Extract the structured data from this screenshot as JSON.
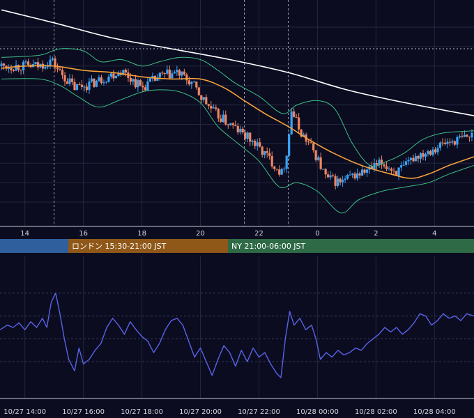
{
  "chart_data": [
    {
      "type": "candlestick",
      "panel": "price",
      "x_unit": "hour",
      "x_range": [
        13.15,
        29.35
      ],
      "y_range": [
        0,
        100
      ],
      "x_ticks": [
        {
          "x": 14,
          "label": "14"
        },
        {
          "x": 16,
          "label": "16"
        },
        {
          "x": 18,
          "label": "18"
        },
        {
          "x": 20,
          "label": "20"
        },
        {
          "x": 22,
          "label": "22"
        },
        {
          "x": 24,
          "label": "0"
        },
        {
          "x": 26,
          "label": "2"
        },
        {
          "x": 28,
          "label": "4"
        }
      ],
      "grid": true,
      "y_gridlines": [
        90,
        81,
        72,
        63,
        54,
        45,
        36,
        27,
        18,
        9
      ],
      "dashed_level": 80,
      "vertical_markers": [
        15,
        21.5,
        23
      ],
      "colors": {
        "up": "#3ba3f5",
        "down": "#f08560",
        "background": "#0b0c20"
      },
      "key_points": [
        {
          "x": 13.2,
          "y": 72
        },
        {
          "x": 14.0,
          "y": 72
        },
        {
          "x": 14.5,
          "y": 72
        },
        {
          "x": 14.9,
          "y": 75
        },
        {
          "x": 15.2,
          "y": 69
        },
        {
          "x": 15.7,
          "y": 62
        },
        {
          "x": 16.3,
          "y": 64
        },
        {
          "x": 16.8,
          "y": 67
        },
        {
          "x": 17.3,
          "y": 70
        },
        {
          "x": 18.0,
          "y": 62
        },
        {
          "x": 18.6,
          "y": 67
        },
        {
          "x": 19.2,
          "y": 69
        },
        {
          "x": 19.7,
          "y": 64
        },
        {
          "x": 20.0,
          "y": 58
        },
        {
          "x": 20.5,
          "y": 50
        },
        {
          "x": 21.0,
          "y": 45
        },
        {
          "x": 21.7,
          "y": 38
        },
        {
          "x": 22.3,
          "y": 30
        },
        {
          "x": 22.8,
          "y": 22
        },
        {
          "x": 23.0,
          "y": 36
        },
        {
          "x": 23.1,
          "y": 52
        },
        {
          "x": 23.4,
          "y": 42
        },
        {
          "x": 23.9,
          "y": 32
        },
        {
          "x": 24.3,
          "y": 20
        },
        {
          "x": 24.8,
          "y": 18
        },
        {
          "x": 25.2,
          "y": 21
        },
        {
          "x": 25.8,
          "y": 24
        },
        {
          "x": 26.2,
          "y": 27
        },
        {
          "x": 26.7,
          "y": 23
        },
        {
          "x": 27.0,
          "y": 25
        },
        {
          "x": 27.3,
          "y": 30
        },
        {
          "x": 27.8,
          "y": 33
        },
        {
          "x": 28.3,
          "y": 36
        },
        {
          "x": 29.35,
          "y": 40
        }
      ],
      "indicators": [
        {
          "kind": "moving_average",
          "color": "#ffffff",
          "points": [
            {
              "x": 13.2,
              "y": 98
            },
            {
              "x": 15.0,
              "y": 92
            },
            {
              "x": 17.0,
              "y": 85
            },
            {
              "x": 19.0,
              "y": 80
            },
            {
              "x": 21.0,
              "y": 75
            },
            {
              "x": 23.0,
              "y": 69
            },
            {
              "x": 25.0,
              "y": 61
            },
            {
              "x": 27.0,
              "y": 55
            },
            {
              "x": 29.35,
              "y": 49
            }
          ]
        },
        {
          "kind": "moving_average",
          "color": "#f5a23a",
          "points": [
            {
              "x": 13.2,
              "y": 71
            },
            {
              "x": 14.0,
              "y": 72
            },
            {
              "x": 15.0,
              "y": 72
            },
            {
              "x": 16.0,
              "y": 70
            },
            {
              "x": 17.0,
              "y": 69
            },
            {
              "x": 18.0,
              "y": 67
            },
            {
              "x": 19.0,
              "y": 66
            },
            {
              "x": 20.0,
              "y": 66
            },
            {
              "x": 20.8,
              "y": 62
            },
            {
              "x": 21.5,
              "y": 56
            },
            {
              "x": 22.2,
              "y": 50
            },
            {
              "x": 23.0,
              "y": 44
            },
            {
              "x": 23.7,
              "y": 38
            },
            {
              "x": 24.5,
              "y": 32
            },
            {
              "x": 25.5,
              "y": 26
            },
            {
              "x": 26.5,
              "y": 22
            },
            {
              "x": 27.2,
              "y": 20
            },
            {
              "x": 27.8,
              "y": 22
            },
            {
              "x": 28.5,
              "y": 26
            },
            {
              "x": 29.35,
              "y": 30
            }
          ]
        },
        {
          "kind": "bollinger_upper",
          "color": "#3dbf86",
          "points": [
            {
              "x": 13.2,
              "y": 76
            },
            {
              "x": 14.5,
              "y": 77
            },
            {
              "x": 15.2,
              "y": 80
            },
            {
              "x": 16.0,
              "y": 79
            },
            {
              "x": 16.6,
              "y": 74
            },
            {
              "x": 17.3,
              "y": 75
            },
            {
              "x": 18.0,
              "y": 72
            },
            {
              "x": 18.6,
              "y": 74
            },
            {
              "x": 19.3,
              "y": 76
            },
            {
              "x": 20.0,
              "y": 75
            },
            {
              "x": 20.6,
              "y": 70
            },
            {
              "x": 21.2,
              "y": 64
            },
            {
              "x": 22.0,
              "y": 58
            },
            {
              "x": 22.8,
              "y": 50
            },
            {
              "x": 23.3,
              "y": 54
            },
            {
              "x": 24.0,
              "y": 56
            },
            {
              "x": 24.6,
              "y": 52
            },
            {
              "x": 25.2,
              "y": 36
            },
            {
              "x": 25.8,
              "y": 26
            },
            {
              "x": 26.4,
              "y": 28
            },
            {
              "x": 27.0,
              "y": 32
            },
            {
              "x": 27.6,
              "y": 38
            },
            {
              "x": 28.3,
              "y": 41
            },
            {
              "x": 29.35,
              "y": 42
            }
          ]
        },
        {
          "kind": "bollinger_lower",
          "color": "#3dbf86",
          "points": [
            {
              "x": 13.2,
              "y": 66
            },
            {
              "x": 14.5,
              "y": 66
            },
            {
              "x": 15.2,
              "y": 63
            },
            {
              "x": 15.8,
              "y": 58
            },
            {
              "x": 16.5,
              "y": 53
            },
            {
              "x": 17.2,
              "y": 56
            },
            {
              "x": 18.0,
              "y": 60
            },
            {
              "x": 18.6,
              "y": 61
            },
            {
              "x": 19.3,
              "y": 60
            },
            {
              "x": 20.0,
              "y": 55
            },
            {
              "x": 20.6,
              "y": 44
            },
            {
              "x": 21.3,
              "y": 36
            },
            {
              "x": 22.0,
              "y": 28
            },
            {
              "x": 22.7,
              "y": 16
            },
            {
              "x": 23.3,
              "y": 18
            },
            {
              "x": 24.0,
              "y": 14
            },
            {
              "x": 24.8,
              "y": 4
            },
            {
              "x": 25.4,
              "y": 10
            },
            {
              "x": 26.2,
              "y": 14
            },
            {
              "x": 27.0,
              "y": 16
            },
            {
              "x": 27.8,
              "y": 18
            },
            {
              "x": 28.5,
              "y": 22
            },
            {
              "x": 29.35,
              "y": 26
            }
          ]
        }
      ]
    },
    {
      "type": "line",
      "panel": "oscillator",
      "x_unit": "hour",
      "x_range": [
        13.15,
        29.35
      ],
      "y_range": [
        0,
        100
      ],
      "grid": true,
      "y_gridlines": [
        80,
        60,
        40,
        20
      ],
      "x_ticks": [
        {
          "x": 14,
          "label": "10/27 14:00"
        },
        {
          "x": 16,
          "label": "10/27 16:00"
        },
        {
          "x": 18,
          "label": "10/27 18:00"
        },
        {
          "x": 20,
          "label": "10/27 20:00"
        },
        {
          "x": 22,
          "label": "10/27 22:00"
        },
        {
          "x": 24,
          "label": "10/28 00:00"
        },
        {
          "x": 26,
          "label": "10/28 02:00"
        },
        {
          "x": 28,
          "label": "10/28 04:00"
        }
      ],
      "series": [
        {
          "color": "#5a63e8",
          "values_xy": [
            [
              13.15,
              48
            ],
            [
              13.4,
              52
            ],
            [
              13.6,
              50
            ],
            [
              13.8,
              54
            ],
            [
              14.0,
              48
            ],
            [
              14.2,
              55
            ],
            [
              14.4,
              50
            ],
            [
              14.6,
              58
            ],
            [
              14.75,
              50
            ],
            [
              14.9,
              72
            ],
            [
              15.05,
              80
            ],
            [
              15.2,
              62
            ],
            [
              15.35,
              40
            ],
            [
              15.5,
              22
            ],
            [
              15.7,
              12
            ],
            [
              15.85,
              32
            ],
            [
              16.0,
              18
            ],
            [
              16.2,
              22
            ],
            [
              16.4,
              30
            ],
            [
              16.6,
              36
            ],
            [
              16.8,
              50
            ],
            [
              17.0,
              58
            ],
            [
              17.2,
              52
            ],
            [
              17.4,
              44
            ],
            [
              17.6,
              55
            ],
            [
              17.8,
              48
            ],
            [
              18.0,
              42
            ],
            [
              18.2,
              38
            ],
            [
              18.4,
              28
            ],
            [
              18.6,
              36
            ],
            [
              18.8,
              48
            ],
            [
              19.0,
              56
            ],
            [
              19.2,
              58
            ],
            [
              19.4,
              52
            ],
            [
              19.6,
              38
            ],
            [
              19.8,
              24
            ],
            [
              20.0,
              32
            ],
            [
              20.2,
              20
            ],
            [
              20.4,
              8
            ],
            [
              20.6,
              22
            ],
            [
              20.8,
              34
            ],
            [
              21.0,
              28
            ],
            [
              21.2,
              16
            ],
            [
              21.4,
              30
            ],
            [
              21.6,
              20
            ],
            [
              21.8,
              32
            ],
            [
              22.0,
              24
            ],
            [
              22.2,
              28
            ],
            [
              22.4,
              18
            ],
            [
              22.6,
              10
            ],
            [
              22.75,
              6
            ],
            [
              22.9,
              40
            ],
            [
              23.05,
              64
            ],
            [
              23.2,
              52
            ],
            [
              23.4,
              58
            ],
            [
              23.6,
              48
            ],
            [
              23.8,
              52
            ],
            [
              23.95,
              40
            ],
            [
              24.1,
              22
            ],
            [
              24.3,
              28
            ],
            [
              24.5,
              24
            ],
            [
              24.7,
              30
            ],
            [
              24.9,
              26
            ],
            [
              25.1,
              28
            ],
            [
              25.3,
              32
            ],
            [
              25.5,
              30
            ],
            [
              25.7,
              36
            ],
            [
              25.9,
              40
            ],
            [
              26.1,
              44
            ],
            [
              26.3,
              50
            ],
            [
              26.5,
              46
            ],
            [
              26.7,
              50
            ],
            [
              26.9,
              44
            ],
            [
              27.1,
              48
            ],
            [
              27.3,
              54
            ],
            [
              27.5,
              62
            ],
            [
              27.7,
              60
            ],
            [
              27.9,
              52
            ],
            [
              28.1,
              56
            ],
            [
              28.3,
              62
            ],
            [
              28.5,
              58
            ],
            [
              28.7,
              60
            ],
            [
              28.9,
              56
            ],
            [
              29.1,
              62
            ],
            [
              29.35,
              60
            ]
          ]
        }
      ]
    }
  ],
  "sessions": [
    {
      "label": "",
      "color": "#2f5f9c"
    },
    {
      "label": "ロンドン 15:30-21:00 JST",
      "color": "#8f5818"
    },
    {
      "label": "NY 21:00-06:00 JST",
      "color": "#2d6a45"
    }
  ]
}
